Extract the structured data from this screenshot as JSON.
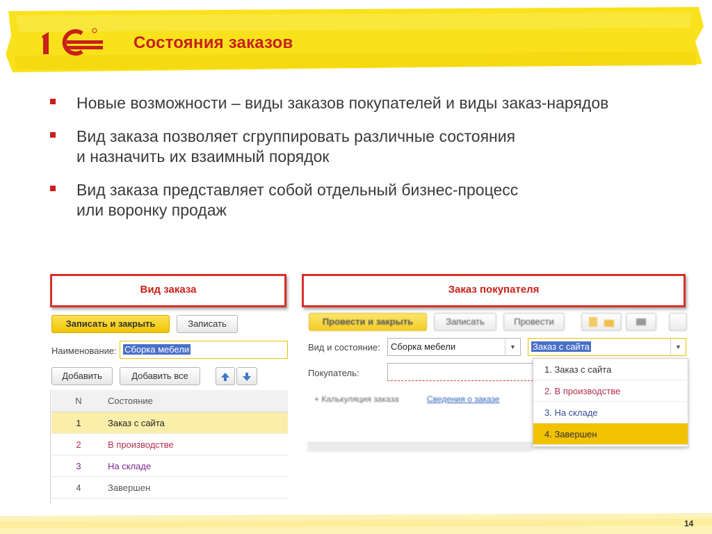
{
  "slide": {
    "title": "Состояния заказов",
    "page_number": "14",
    "bullets": [
      "Новые возможности – виды заказов покупателей и виды заказ-нарядов",
      "Вид заказа позволяет сгруппировать различные состояния\nи назначить их взаимный порядок",
      "Вид заказа представляет собой отдельный бизнес-процесс\nили воронку продаж"
    ]
  },
  "colors": {
    "accent": "#c8201a",
    "highlighter": "#f9e21c",
    "selection": "#f2c100"
  },
  "order_type_window": {
    "title": "Вид заказа",
    "save_close_label": "Записать и закрыть",
    "save_label": "Записать",
    "name_label": "Наименование:",
    "name_value": "Сборка мебели",
    "add_label": "Добавить",
    "add_all_label": "Добавить все",
    "columns": [
      "N",
      "Состояние"
    ],
    "rows": [
      {
        "n": "1",
        "state": "Заказ с сайта",
        "color": "#222222"
      },
      {
        "n": "2",
        "state": "В производстве",
        "color": "#b5304f"
      },
      {
        "n": "3",
        "state": "На складе",
        "color": "#7a2a8a"
      },
      {
        "n": "4",
        "state": "Завершен",
        "color": "#555555"
      }
    ]
  },
  "customer_order_window": {
    "title": "Заказ покупателя",
    "post_close_label": "Провести и закрыть",
    "save_label": "Записать",
    "post_label": "Провести",
    "type_state_label": "Вид и состояние:",
    "type_value": "Сборка мебели",
    "state_value": "Заказ с сайта",
    "customer_label": "Покупатель:",
    "calc_link": "+ Калькуляция заказа",
    "info_link": "Сведения о заказе",
    "dropdown_options": [
      {
        "label": "1. Заказ с сайта",
        "color": "#333333"
      },
      {
        "label": "2. В производстве",
        "color": "#b5304f"
      },
      {
        "label": "3. На складе",
        "color": "#3a4d9a"
      },
      {
        "label": "4. Завершен",
        "color": "#333333"
      }
    ]
  }
}
